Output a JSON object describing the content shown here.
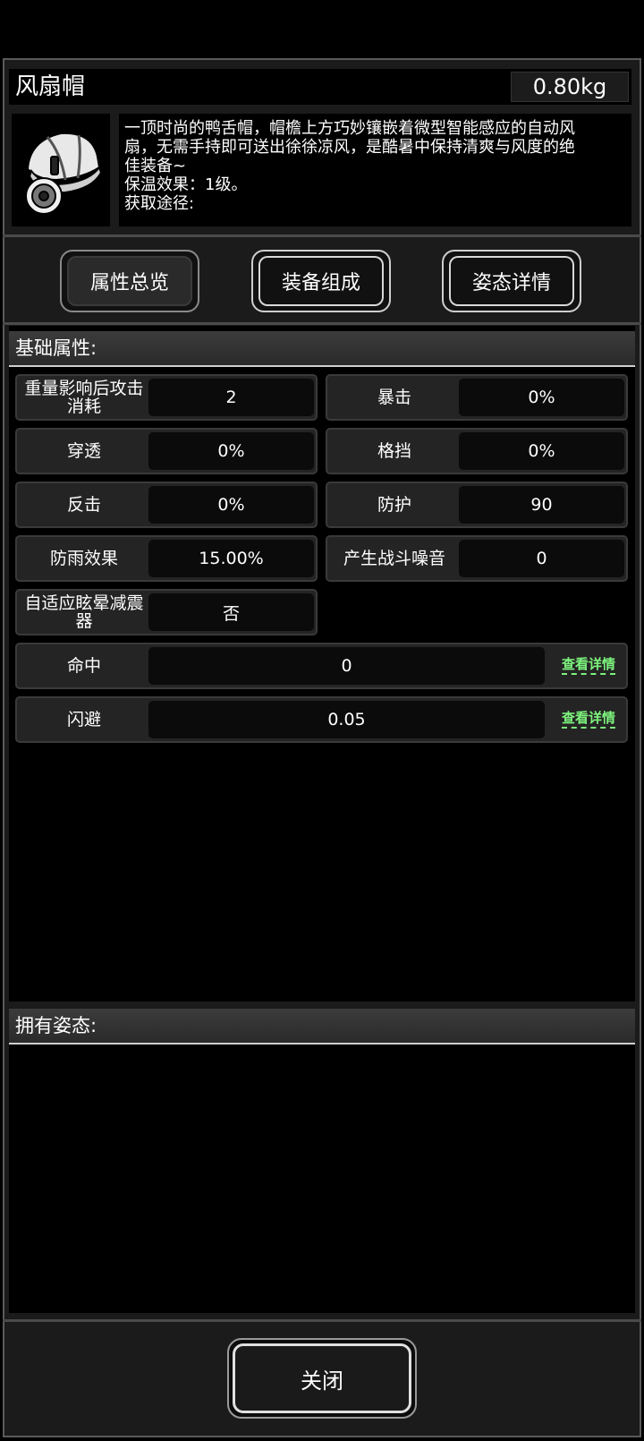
{
  "item": {
    "name": "风扇帽",
    "weight": "0.80kg",
    "icon": "fan-cap-icon",
    "description": [
      "一顶时尚的鸭舌帽，帽檐上方巧妙镶嵌着微型智能感应的自动风",
      "扇，无需手持即可送出徐徐凉风，是酷暑中保持清爽与风度的绝",
      "佳装备~",
      "保温效果：1级。",
      "获取途径:"
    ]
  },
  "tabs": [
    {
      "label": "属性总览"
    },
    {
      "label": "装备组成"
    },
    {
      "label": "姿态详情"
    }
  ],
  "basic_section": {
    "title": "基础属性:"
  },
  "stats": [
    {
      "label": "重量影响后攻击消耗",
      "value": "2"
    },
    {
      "label": "暴击",
      "value": "0%"
    },
    {
      "label": "穿透",
      "value": "0%"
    },
    {
      "label": "格挡",
      "value": "0%"
    },
    {
      "label": "反击",
      "value": "0%"
    },
    {
      "label": "防护",
      "value": "90"
    },
    {
      "label": "防雨效果",
      "value": "15.00%"
    },
    {
      "label": "产生战斗噪音",
      "value": "0"
    },
    {
      "label": "自适应眩晕减震器",
      "value": "否"
    }
  ],
  "wide_stats": [
    {
      "label": "命中",
      "value": "0",
      "link": "查看详情"
    },
    {
      "label": "闪避",
      "value": "0.05",
      "link": "查看详情"
    }
  ],
  "pose_section": {
    "title": "拥有姿态:"
  },
  "close_label": "关闭",
  "colors": {
    "link_green": "#7df37d",
    "panel": "#1b1b1b"
  }
}
